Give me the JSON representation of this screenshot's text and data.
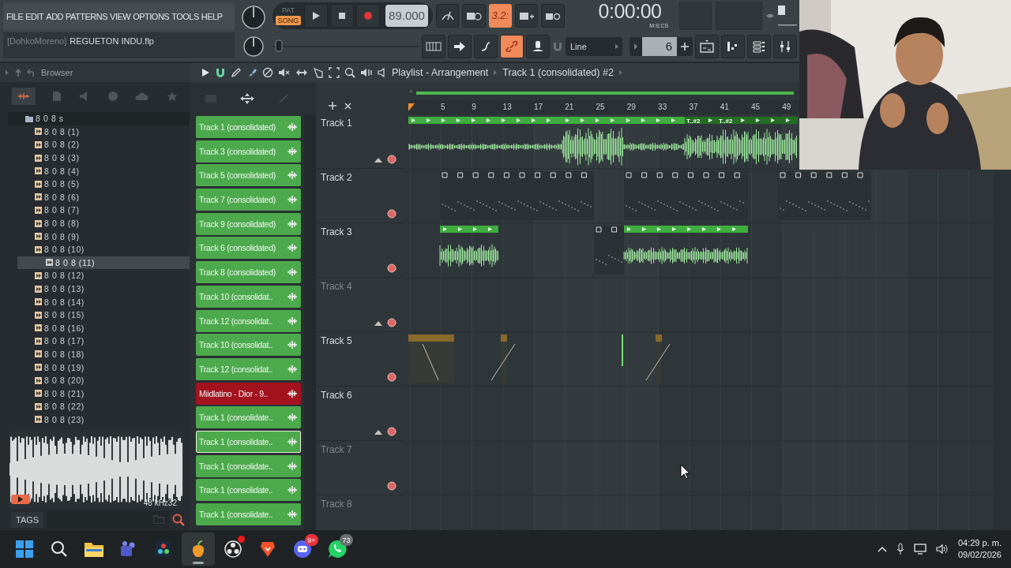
{
  "menu": [
    "FILE",
    "EDIT",
    "ADD",
    "PATTERNS",
    "VIEW",
    "OPTIONS",
    "TOOLS",
    "HELP"
  ],
  "hint": {
    "user": "[DohkoMoreno]",
    "file": "REGUETON INDU.flp"
  },
  "transport": {
    "modes": [
      {
        "label": "PAT",
        "selected": false
      },
      {
        "label": "SONG",
        "selected": true
      }
    ],
    "tempo": "89.000"
  },
  "countdown": {
    "label": "3.2:",
    "on": true
  },
  "clock": {
    "value": "0:00:00",
    "unit": "M:S:CS"
  },
  "link": {
    "on": true
  },
  "pitch": {
    "level": 0.02
  },
  "snap": {
    "value": "Line"
  },
  "pattern": {
    "value": "6"
  },
  "browser": {
    "title": "Browser",
    "tree": [
      {
        "label": "8 0 8 s",
        "children": [
          {
            "label": "8 0 8 (1)",
            "selected": false
          },
          {
            "label": "8 0 8 (2)",
            "selected": false
          },
          {
            "label": "8 0 8 (3)",
            "selected": false
          },
          {
            "label": "8 0 8 (4)",
            "selected": false
          },
          {
            "label": "8 0 8 (5)",
            "selected": false
          },
          {
            "label": "8 0 8 (6)",
            "selected": false
          },
          {
            "label": "8 0 8 (7)",
            "selected": false
          },
          {
            "label": "8 0 8 (8)",
            "selected": false
          },
          {
            "label": "8 0 8 (9)",
            "selected": false
          },
          {
            "label": "8 0 8 (10)",
            "selected": false
          },
          {
            "label": "8 0 8 (11)",
            "selected": true
          },
          {
            "label": "8 0 8 (12)",
            "selected": false
          },
          {
            "label": "8 0 8 (13)",
            "selected": false
          },
          {
            "label": "8 0 8 (14)",
            "selected": false
          },
          {
            "label": "8 0 8 (15)",
            "selected": false
          },
          {
            "label": "8 0 8 (16)",
            "selected": false
          },
          {
            "label": "8 0 8 (17)",
            "selected": false
          },
          {
            "label": "8 0 8 (18)",
            "selected": false
          },
          {
            "label": "8 0 8 (19)",
            "selected": false
          },
          {
            "label": "8 0 8 (20)",
            "selected": false
          },
          {
            "label": "8 0 8 (21)",
            "selected": false
          },
          {
            "label": "8 0 8 (22)",
            "selected": false
          },
          {
            "label": "8 0 8 (23)",
            "selected": false
          }
        ]
      }
    ]
  },
  "preview": {
    "info": "48 kHz32"
  },
  "tags": {
    "label": "TAGS"
  },
  "clips": [
    {
      "label": "Track 1 (consolidated)",
      "color": "#4caa4c",
      "selected": false
    },
    {
      "label": "Track 3 (consolidated)",
      "color": "#4caa4c",
      "selected": false
    },
    {
      "label": "Track 5 (consolidated)",
      "color": "#4caa4c",
      "selected": false
    },
    {
      "label": "Track 7 (consolidated)",
      "color": "#4caa4c",
      "selected": false
    },
    {
      "label": "Track 9 (consolidated)",
      "color": "#4caa4c",
      "selected": false
    },
    {
      "label": "Track 6 (consolidated)",
      "color": "#4caa4c",
      "selected": false
    },
    {
      "label": "Track 8 (consolidated)",
      "color": "#4caa4c",
      "selected": false
    },
    {
      "label": "Track 10 (consolidat..",
      "color": "#4caa4c",
      "selected": false
    },
    {
      "label": "Track 12 (consolidat..",
      "color": "#4caa4c",
      "selected": false
    },
    {
      "label": "Track 10 (consolidat..",
      "color": "#4caa4c",
      "selected": false
    },
    {
      "label": "Track 12 (consolidat..",
      "color": "#4caa4c",
      "selected": false
    },
    {
      "label": "Miidlatino - Dior - 9..",
      "color": "#a3121f",
      "selected": false
    },
    {
      "label": "Track 1 (consolidate..",
      "color": "#4caa4c",
      "selected": false
    },
    {
      "label": "Track 1 (consolidate..",
      "color": "#4caa4c",
      "selected": true
    },
    {
      "label": "Track 1 (consolidate..",
      "color": "#4caa4c",
      "selected": false
    },
    {
      "label": "Track 1 (consolidate..",
      "color": "#4caa4c",
      "selected": false
    },
    {
      "label": "Track 1 (consolidate..",
      "color": "#4caa4c",
      "selected": false
    }
  ],
  "playlist": {
    "title": "Playlist - Arrangement",
    "crumb": "Track 1 (consolidated) #2",
    "ruler": [
      "5",
      "9",
      "13",
      "17",
      "21",
      "25",
      "29",
      "33",
      "37",
      "41",
      "45",
      "49"
    ],
    "tracks": [
      {
        "name": "Track 1",
        "dimmed": false,
        "group_toggle": true,
        "mute_dot": true
      },
      {
        "name": "Track 2",
        "dimmed": false,
        "group_toggle": false,
        "mute_dot": true
      },
      {
        "name": "Track 3",
        "dimmed": false,
        "group_toggle": false,
        "mute_dot": true
      },
      {
        "name": "Track 4",
        "dimmed": true,
        "group_toggle": true,
        "mute_dot": true
      },
      {
        "name": "Track 5",
        "dimmed": false,
        "group_toggle": false,
        "mute_dot": true
      },
      {
        "name": "Track 6",
        "dimmed": false,
        "group_toggle": true,
        "mute_dot": true
      },
      {
        "name": "Track 7",
        "dimmed": true,
        "group_toggle": false,
        "mute_dot": true
      },
      {
        "name": "Track 8",
        "dimmed": true,
        "group_toggle": false,
        "mute_dot": false
      }
    ],
    "clip_labels": [
      "T..#2",
      "T..#2"
    ]
  },
  "taskbar": {
    "apps": [
      {
        "kind": "start",
        "active": false
      },
      {
        "kind": "search",
        "active": false
      },
      {
        "kind": "files",
        "active": false
      },
      {
        "kind": "teams",
        "active": false
      },
      {
        "kind": "resolve",
        "active": false
      },
      {
        "kind": "fl",
        "active": true
      },
      {
        "kind": "obs",
        "active": false,
        "dot": true
      },
      {
        "kind": "brave",
        "active": false
      },
      {
        "kind": "discord",
        "active": false,
        "badge": "9+"
      },
      {
        "kind": "whatsapp",
        "active": false,
        "badge": "73"
      }
    ],
    "time": "04:29 p. m.",
    "date": "09/02/2026"
  }
}
